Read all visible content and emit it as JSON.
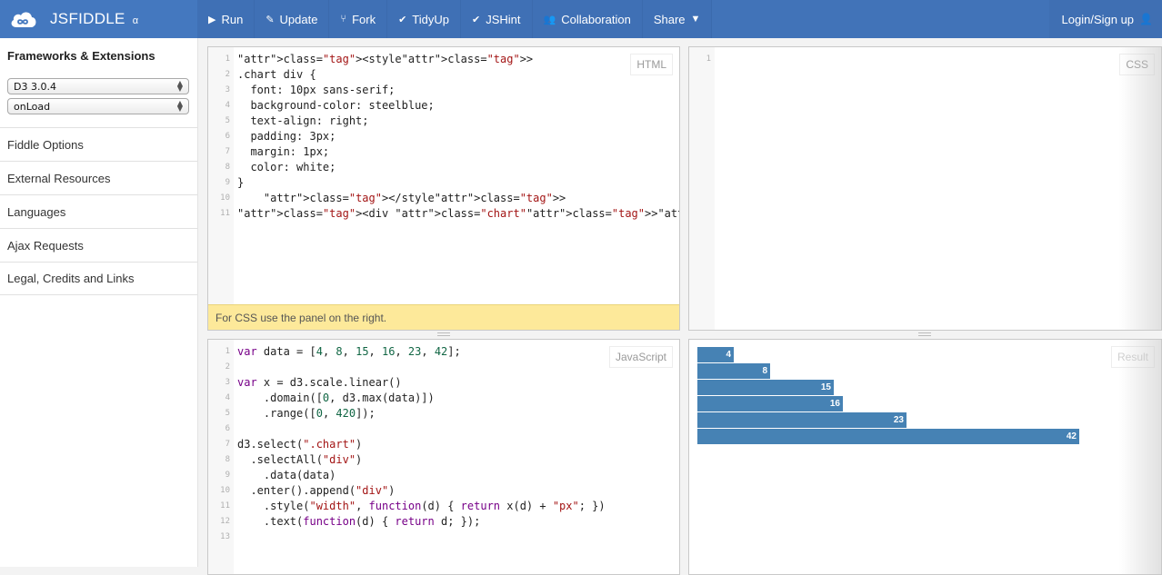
{
  "topbar": {
    "brand": "JSFIDDLE",
    "brand_suffix": "α",
    "actions": [
      {
        "label": "Run",
        "icon": "play-icon",
        "glyph": "▶"
      },
      {
        "label": "Update",
        "icon": "pencil-icon",
        "glyph": "✎"
      },
      {
        "label": "Fork",
        "icon": "fork-icon",
        "glyph": "⑂"
      },
      {
        "label": "TidyUp",
        "icon": "brush-icon",
        "glyph": "✔"
      },
      {
        "label": "JSHint",
        "icon": "check-icon",
        "glyph": "✔"
      },
      {
        "label": "Collaboration",
        "icon": "users-icon",
        "glyph": "👥"
      },
      {
        "label": "Share",
        "icon": "caret-down-icon",
        "glyph": "▼"
      }
    ],
    "login": "Login/Sign up",
    "login_icon": "user-icon"
  },
  "sidebar": {
    "title": "Frameworks & Extensions",
    "framework_select": "D3 3.0.4",
    "load_select": "onLoad",
    "items": [
      "Fiddle Options",
      "External Resources",
      "Languages",
      "Ajax Requests",
      "Legal, Credits and Links"
    ]
  },
  "panels": {
    "html_label": "HTML",
    "css_label": "CSS",
    "js_label": "JavaScript",
    "result_label": "Result",
    "html_notice": "For CSS use the panel on the right.",
    "html_code": [
      "<style>",
      ".chart div {",
      "  font: 10px sans-serif;",
      "  background-color: steelblue;",
      "  text-align: right;",
      "  padding: 3px;",
      "  margin: 1px;",
      "  color: white;",
      "}",
      "    </style>",
      "<div class=\"chart\"></div>"
    ],
    "css_code": [
      ""
    ],
    "js_code": [
      "var data = [4, 8, 15, 16, 23, 42];",
      "",
      "var x = d3.scale.linear()",
      "    .domain([0, d3.max(data)])",
      "    .range([0, 420]);",
      "",
      "d3.select(\".chart\")",
      "  .selectAll(\"div\")",
      "    .data(data)",
      "  .enter().append(\"div\")",
      "    .style(\"width\", function(d) { return x(d) + \"px\"; })",
      "    .text(function(d) { return d; });",
      ""
    ]
  },
  "result": {
    "values": [
      4,
      8,
      15,
      16,
      23,
      42
    ],
    "bar_color": "#4682b4"
  }
}
